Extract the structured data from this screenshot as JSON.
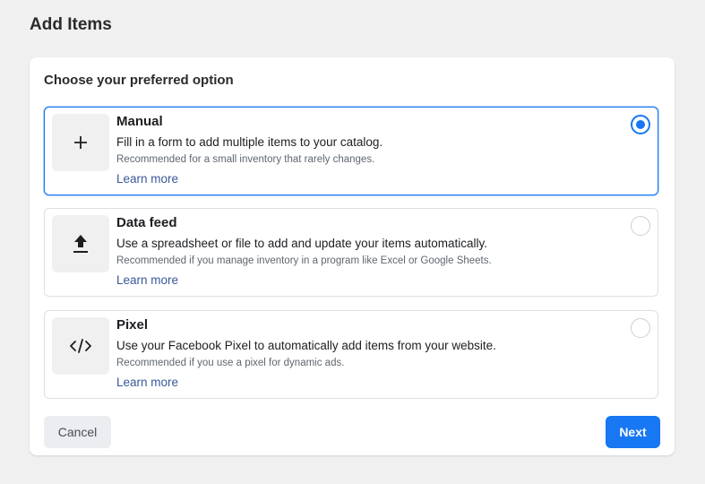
{
  "page": {
    "title": "Add Items"
  },
  "card": {
    "heading": "Choose your preferred option"
  },
  "options": [
    {
      "title": "Manual",
      "description": "Fill in a form to add multiple items to your catalog.",
      "recommendation": "Recommended for a small inventory that rarely changes.",
      "link": "Learn more",
      "icon": "plus-icon",
      "selected": true
    },
    {
      "title": "Data feed",
      "description": "Use a spreadsheet or file to add and update your items automatically.",
      "recommendation": "Recommended if you manage inventory in a program like Excel or Google Sheets.",
      "link": "Learn more",
      "icon": "upload-icon",
      "selected": false
    },
    {
      "title": "Pixel",
      "description": "Use your Facebook Pixel to automatically add items from your website.",
      "recommendation": "Recommended if you use a pixel for dynamic ads.",
      "link": "Learn more",
      "icon": "code-icon",
      "selected": false
    }
  ],
  "actions": {
    "cancel_label": "Cancel",
    "next_label": "Next"
  },
  "colors": {
    "accent": "#1877f2",
    "link": "#385898",
    "background": "#f0f0f0"
  }
}
